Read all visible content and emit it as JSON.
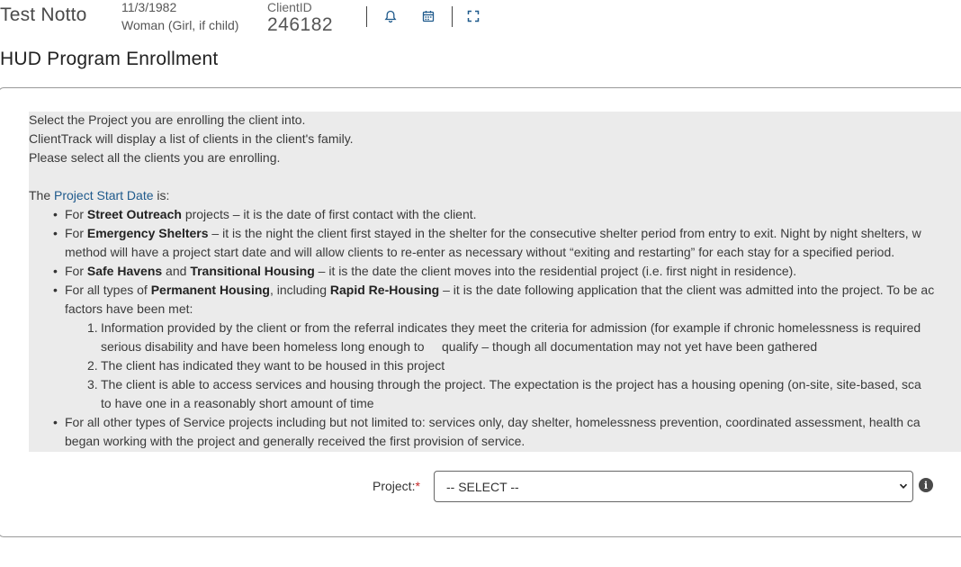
{
  "header": {
    "client_name": "Test Notto",
    "dob": "11/3/1982",
    "gender": "Woman (Girl, if child)",
    "client_id_label": "ClientID",
    "client_id": "246182",
    "icons": [
      "bell-icon",
      "calendar-icon",
      "expand-icon"
    ]
  },
  "page_title": "HUD Program Enrollment",
  "instructions": {
    "intro": [
      "Select the Project you are enrolling the client into.",
      "ClientTrack will display a list of clients in the client's family.",
      "Please select all the clients you are enrolling."
    ],
    "start_date_prefix": "The ",
    "start_date_link": "Project Start Date",
    "start_date_suffix": " is:",
    "b1_pre": "For ",
    "b1_bold": "Street Outreach",
    "b1_post": " projects – it is the date of first contact with the client.",
    "b2_pre": "For ",
    "b2_bold": "Emergency Shelters",
    "b2_post": " – it is the night the client first stayed in the shelter for the consecutive shelter period from entry to exit. Night by night shelters, w",
    "b2_line2": "method will have a project start date and will allow clients to re-enter as necessary without “exiting and restarting” for each stay for a specified period.",
    "b3_pre": "For ",
    "b3_bold1": "Safe Havens",
    "b3_mid": " and ",
    "b3_bold2": "Transitional Housing",
    "b3_post": " – it is the date the client moves into the residential project (i.e. first night in residence).",
    "b4_pre": "For all types of ",
    "b4_bold1": "Permanent Housing",
    "b4_mid": ", including ",
    "b4_bold2": "Rapid Re-Housing",
    "b4_post": " – it is the date following application that the client was admitted into the project. To be ac",
    "b4_line2": "factors have been met:",
    "n1_line1": "Information provided by the client or from the referral indicates they meet the criteria for admission (for example if chronic homelessness is required",
    "n1_line2": "serious disability and have been homeless long enough to     qualify – though all documentation may not yet have been gathered",
    "n2": "The client has indicated they want to be housed in this project",
    "n3_line1": "The client is able to access services and housing through the project. The expectation is the project has a housing opening (on-site, site-based, sca",
    "n3_line2": "to have one in a reasonably short amount of time",
    "b5_line1": "For all other types of Service projects including but not limited to: services only, day shelter, homelessness prevention, coordinated assessment, health ca",
    "b5_line2": "began working with the project and generally received the first provision of service."
  },
  "form": {
    "project_label": "Project:",
    "required_mark": "*",
    "project_value": "-- SELECT --"
  },
  "colors": {
    "instructions_bg": "#ebebeb",
    "link": "#1f5a8c",
    "required": "#c62828"
  }
}
